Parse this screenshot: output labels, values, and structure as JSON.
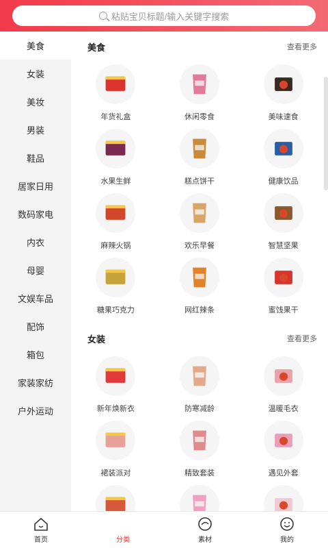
{
  "search": {
    "placeholder": "粘贴宝贝标题/输入关键字搜索"
  },
  "sidebar": {
    "items": [
      {
        "label": "美食",
        "active": true
      },
      {
        "label": "女装"
      },
      {
        "label": "美妆"
      },
      {
        "label": "男装"
      },
      {
        "label": "鞋品"
      },
      {
        "label": "居家日用"
      },
      {
        "label": "数码家电"
      },
      {
        "label": "内衣"
      },
      {
        "label": "母婴"
      },
      {
        "label": "文娱车品"
      },
      {
        "label": "配饰"
      },
      {
        "label": "箱包"
      },
      {
        "label": "家装家纺"
      },
      {
        "label": "户外运动"
      }
    ]
  },
  "sections": [
    {
      "title": "美食",
      "more": "查看更多",
      "items": [
        {
          "label": "年货礼盒",
          "icon": "gift-box-icon",
          "color": "#d9352e"
        },
        {
          "label": "休闲零食",
          "icon": "snack-bag-icon",
          "color": "#e27a9a"
        },
        {
          "label": "美味速食",
          "icon": "instant-food-icon",
          "color": "#3a2a22"
        },
        {
          "label": "水果生鲜",
          "icon": "fruit-icon",
          "color": "#7a2a4e"
        },
        {
          "label": "糕点饼干",
          "icon": "cookie-icon",
          "color": "#c98a3a"
        },
        {
          "label": "健康饮品",
          "icon": "drink-icon",
          "color": "#2a5fa8"
        },
        {
          "label": "麻辣火锅",
          "icon": "hotpot-icon",
          "color": "#d2472b"
        },
        {
          "label": "欢乐早餐",
          "icon": "bread-icon",
          "color": "#d9a466"
        },
        {
          "label": "智慧坚果",
          "icon": "nuts-icon",
          "color": "#8a5a2e"
        },
        {
          "label": "糖果巧克力",
          "icon": "chocolate-icon",
          "color": "#c8a23a"
        },
        {
          "label": "网红辣条",
          "icon": "spicy-strip-icon",
          "color": "#e2832b"
        },
        {
          "label": "蜜饯果干",
          "icon": "dried-fruit-icon",
          "color": "#d8342c"
        }
      ]
    },
    {
      "title": "女装",
      "more": "查看更多",
      "items": [
        {
          "label": "新年焕新衣",
          "icon": "sweater-icon",
          "color": "#e23a3a"
        },
        {
          "label": "防寒减龄",
          "icon": "coat-icon",
          "color": "#e4a88a"
        },
        {
          "label": "温暖毛衣",
          "icon": "knit-sweater-icon",
          "color": "#e8a2a8"
        },
        {
          "label": "裙装派对",
          "icon": "dress-icon",
          "color": "#e8a098"
        },
        {
          "label": "精致套装",
          "icon": "suit-dress-icon",
          "color": "#e08a8e"
        },
        {
          "label": "遇见外套",
          "icon": "jacket-icon",
          "color": "#e7a0b8"
        },
        {
          "label": "",
          "icon": "long-coat-icon",
          "color": "#d8583a"
        },
        {
          "label": "",
          "icon": "hoodie-icon",
          "color": "#f0a0c0"
        },
        {
          "label": "",
          "icon": "printed-sweater-icon",
          "color": "#f0c8d0"
        }
      ]
    }
  ],
  "tabbar": {
    "items": [
      {
        "label": "首页",
        "icon": "home-icon"
      },
      {
        "label": "分类",
        "icon": "category-icon",
        "active": true
      },
      {
        "label": "素材",
        "icon": "material-icon"
      },
      {
        "label": "我的",
        "icon": "profile-icon"
      }
    ]
  }
}
